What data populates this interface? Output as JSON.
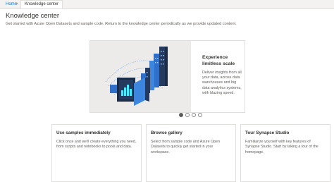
{
  "breadcrumb": {
    "home": "Home",
    "current": "Knowledge center"
  },
  "page": {
    "title": "Knowledge center",
    "subtitle": "Get started with Azure Open Datasets and sample code. Return to the knowledge center periodically as we provide updated content."
  },
  "hero": {
    "title": "Experience limitless scale",
    "description": "Deliver insights from all your data, across data warehouses and big data analytics systems, with blazing speed.",
    "slide_count": 4,
    "active_slide": 1
  },
  "cards": [
    {
      "title": "Use samples immediately",
      "description": "Click once and we'll create everything you need, from scripts and notebooks to pools and data."
    },
    {
      "title": "Browse gallery",
      "description": "Select from sample code and Azure Open Datasets to quickly get started in your workspace."
    },
    {
      "title": "Tour Synapse Studio",
      "description": "Familiarize yourself with key features of Synapse Studio. Start by taking a tour of the homepage."
    }
  ],
  "colors": {
    "accent": "#0078d4",
    "illustration_dark": "#243a5e",
    "illustration_mid": "#2f6fc9",
    "illustration_light": "#50e6ff"
  }
}
